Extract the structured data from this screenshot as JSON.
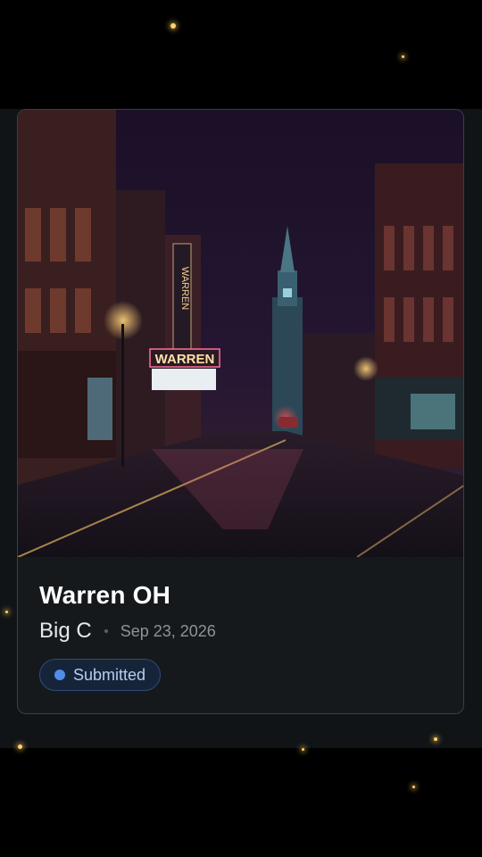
{
  "card": {
    "image_alt": "Night street scene with WARREN theater marquee and church steeple",
    "marquee_text": "WARREN",
    "title": "Warren OH",
    "author": "Big C",
    "date": "Sep 23, 2026",
    "status": {
      "label": "Submitted",
      "color": "#4f8fe8"
    }
  }
}
